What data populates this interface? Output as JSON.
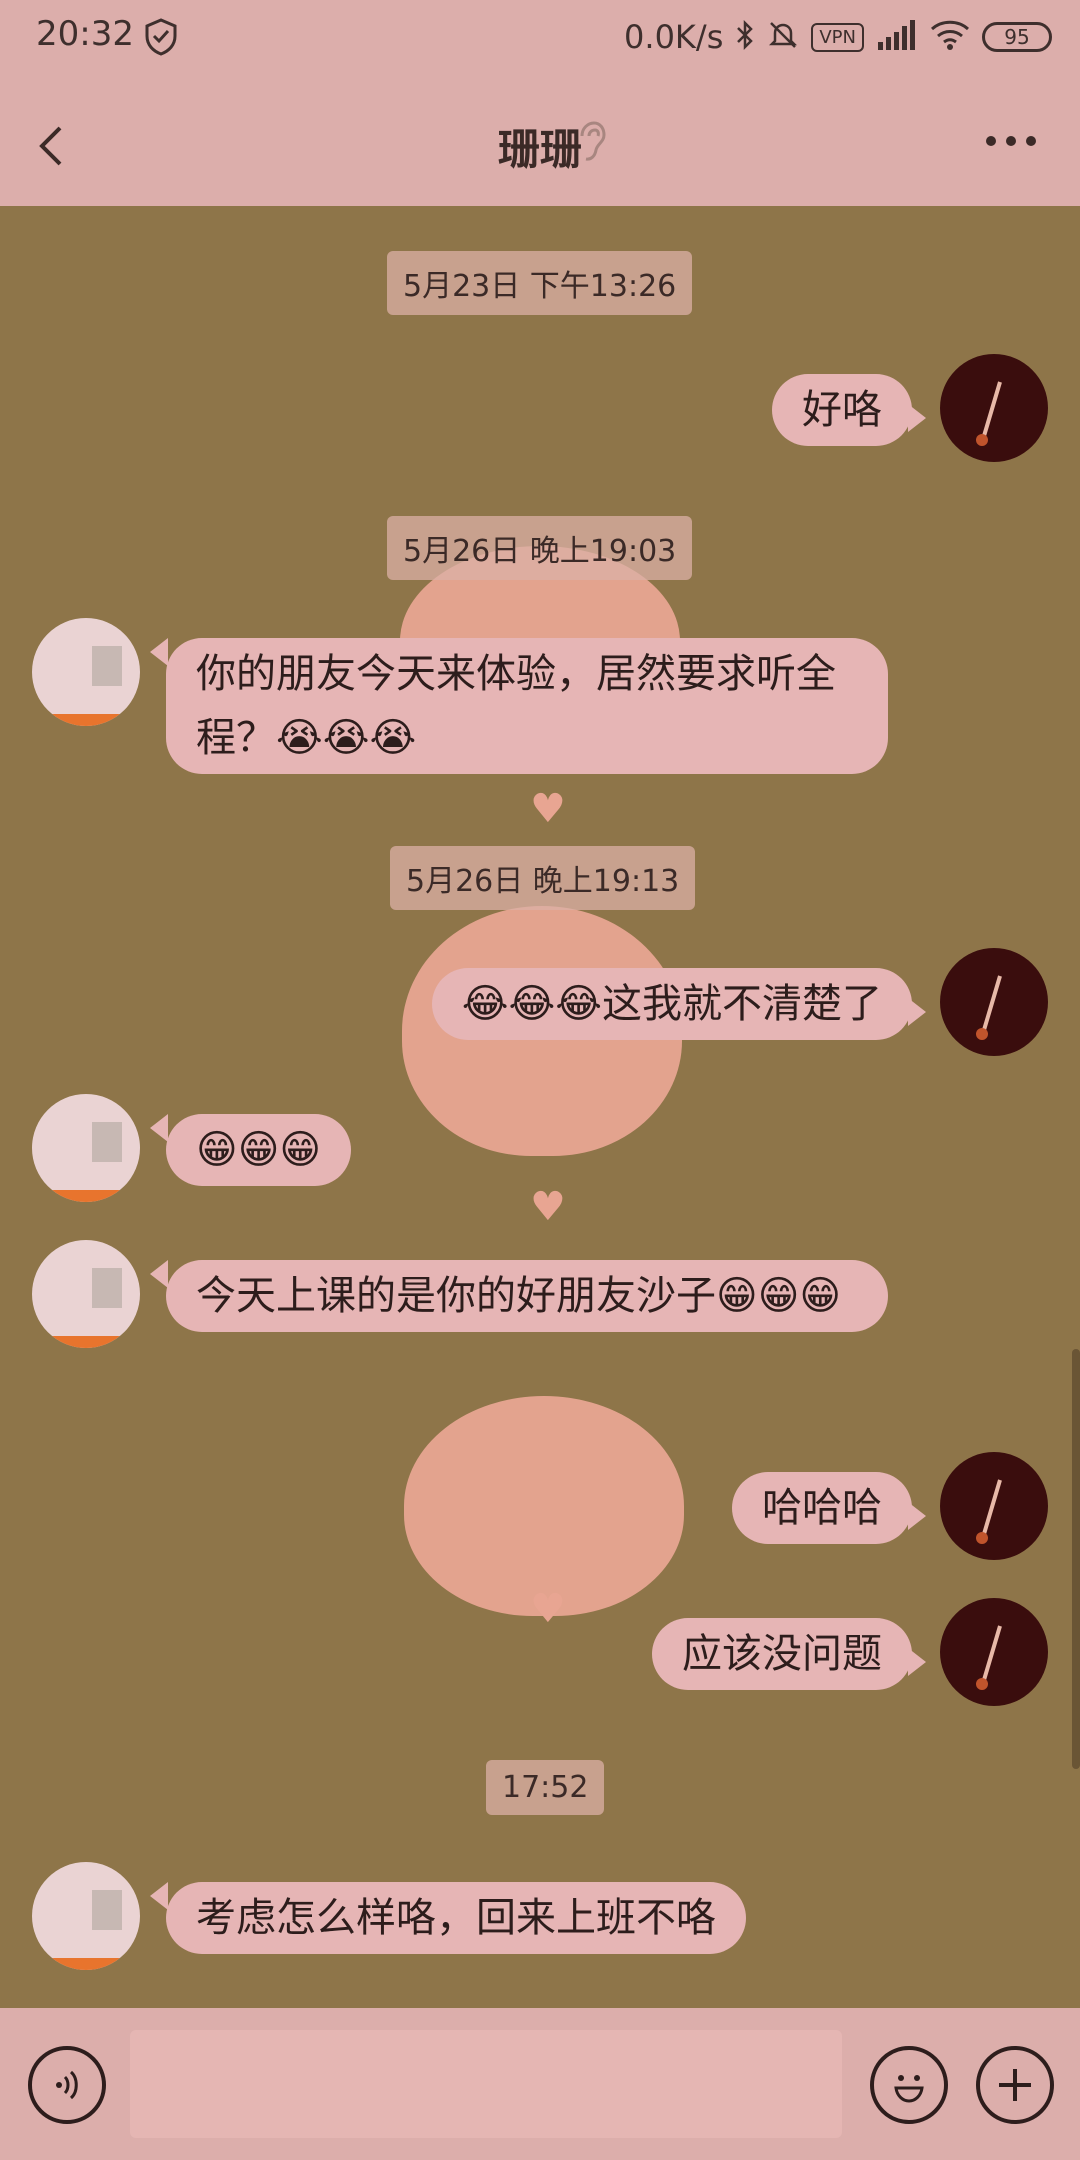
{
  "status_bar": {
    "time": "20:32",
    "speed": "0.0K/s",
    "vpn": "VPN",
    "battery": "95"
  },
  "header": {
    "title": "珊珊"
  },
  "timestamps": [
    "5月23日 下午13:26",
    "5月26日 晚上19:03",
    "5月26日 晚上19:13",
    "17:52"
  ],
  "messages": [
    {
      "sender": "me",
      "text": "好咯"
    },
    {
      "sender": "them",
      "text": "你的朋友今天来体验，居然要求听全程？😭😭😭"
    },
    {
      "sender": "me",
      "text": "😂😂😂这我就不清楚了"
    },
    {
      "sender": "them",
      "text": "😁😁😁"
    },
    {
      "sender": "them",
      "text": "今天上课的是你的好朋友沙子😁😁😁"
    },
    {
      "sender": "me",
      "text": "哈哈哈"
    },
    {
      "sender": "me",
      "text": "应该没问题"
    },
    {
      "sender": "them",
      "text": "考虑怎么样咯，回来上班不咯"
    }
  ],
  "input": {
    "placeholder": ""
  },
  "colors": {
    "chat_bg": "#8e7549",
    "bubble": "#e6b5b5",
    "header_bg": "#dcaeab"
  }
}
